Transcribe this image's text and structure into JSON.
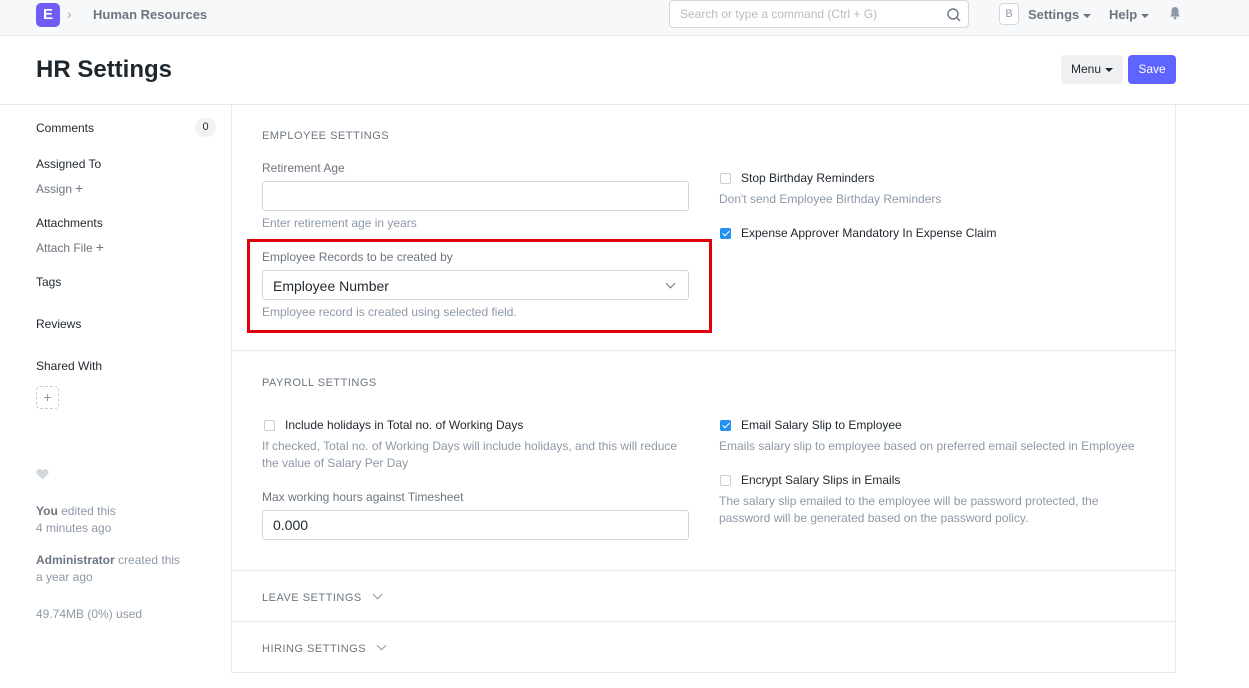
{
  "navbar": {
    "logo_letter": "E",
    "breadcrumb": "Human Resources",
    "search_placeholder": "Search or type a command (Ctrl + G)",
    "avatar_letter": "B",
    "settings_label": "Settings",
    "help_label": "Help"
  },
  "page": {
    "title": "HR Settings",
    "menu_label": "Menu",
    "save_label": "Save"
  },
  "sidebar": {
    "comments_label": "Comments",
    "comments_count": "0",
    "assigned_to_label": "Assigned To",
    "assign_link": "Assign",
    "attachments_label": "Attachments",
    "attach_file_link": "Attach File",
    "tags_label": "Tags",
    "reviews_label": "Reviews",
    "shared_with_label": "Shared With",
    "edited_user": "You",
    "edited_text": " edited this",
    "edited_time": "4 minutes ago",
    "created_user": "Administrator",
    "created_text": " created this",
    "created_time": "a year ago",
    "storage_used": "49.74MB (0%) used"
  },
  "employee_settings": {
    "heading": "EMPLOYEE SETTINGS",
    "retirement_age_label": "Retirement Age",
    "retirement_age_value": "",
    "retirement_age_help": "Enter retirement age in years",
    "records_created_by_label": "Employee Records to be created by",
    "records_created_by_value": "Employee Number",
    "records_created_by_help": "Employee record is created using selected field.",
    "stop_birthday_label": "Stop Birthday Reminders",
    "stop_birthday_checked": false,
    "stop_birthday_help": "Don't send Employee Birthday Reminders",
    "expense_approver_label": "Expense Approver Mandatory In Expense Claim",
    "expense_approver_checked": true
  },
  "payroll_settings": {
    "heading": "PAYROLL SETTINGS",
    "include_holidays_label": "Include holidays in Total no. of Working Days",
    "include_holidays_checked": false,
    "include_holidays_help_1": "If checked, Total no. of Working Days will include holidays, and this will reduce",
    "include_holidays_help_2": "the value of Salary Per Day",
    "max_hours_label": "Max working hours against Timesheet",
    "max_hours_value": "0.000",
    "email_slip_label": "Email Salary Slip to Employee",
    "email_slip_checked": true,
    "email_slip_help": "Emails salary slip to employee based on preferred email selected in Employee",
    "encrypt_label": "Encrypt Salary Slips in Emails",
    "encrypt_checked": false,
    "encrypt_help_1": "The salary slip emailed to the employee will be password protected, the",
    "encrypt_help_2": "password will be generated based on the password policy."
  },
  "collapsed_sections": {
    "leave": "LEAVE SETTINGS",
    "hiring": "HIRING SETTINGS"
  },
  "colors": {
    "primary": "#5e64ff",
    "logo": "#6f5ef5",
    "checkbox_checked": "#2490ef",
    "highlight_border": "#e0000b"
  }
}
